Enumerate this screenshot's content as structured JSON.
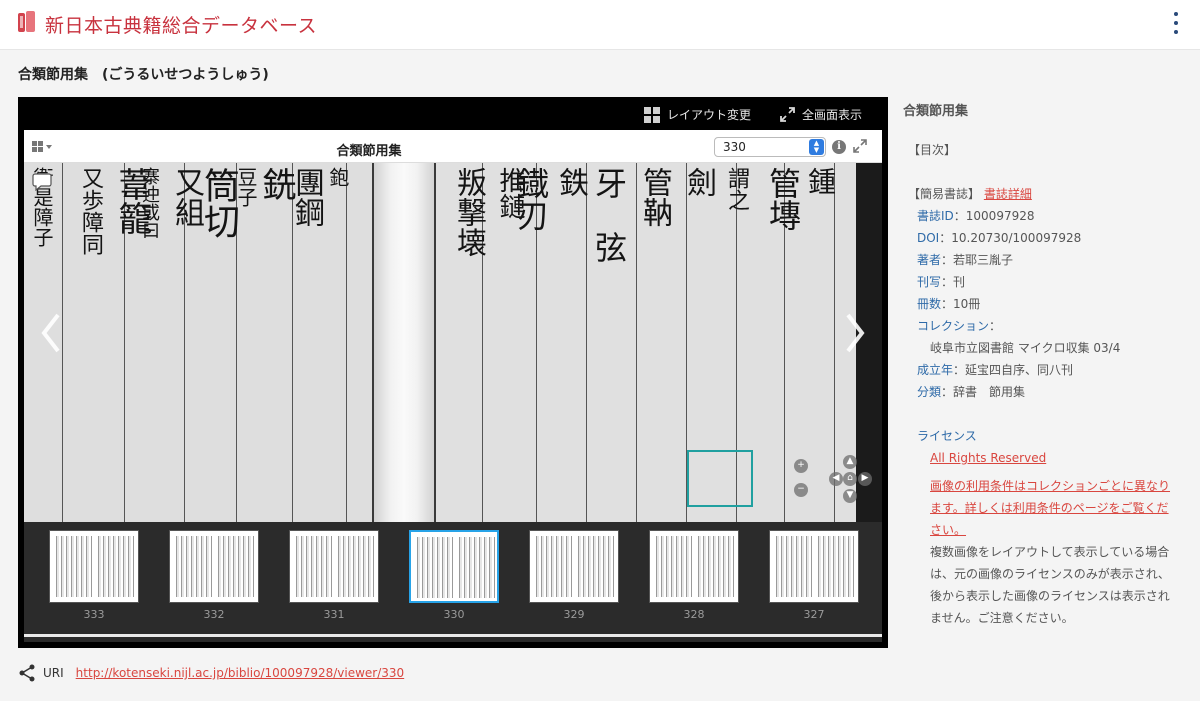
{
  "app": {
    "title": "新日本古典籍総合データベース"
  },
  "page": {
    "title": "合類節用集　(ごうるいせつようしゅう)"
  },
  "viewer": {
    "toolbar": {
      "layout_label": "レイアウト変更",
      "fullscreen_label": "全画面表示"
    },
    "inner_title": "合類節用集",
    "page_select_value": "330",
    "info_glyph": "i",
    "current_page": 330,
    "thumbnails": [
      {
        "label": "333"
      },
      {
        "label": "332"
      },
      {
        "label": "331"
      },
      {
        "label": "330"
      },
      {
        "label": "329"
      },
      {
        "label": "328"
      },
      {
        "label": "327"
      }
    ],
    "accent_color": "#27a3e8"
  },
  "side": {
    "title": "合類節用集",
    "toc": "【目次】",
    "bib_label": "【簡易書誌】",
    "bib_link": "書誌詳細",
    "fields": [
      {
        "label": "書誌ID",
        "value": "：100097928"
      },
      {
        "label": "DOI",
        "value": "：10.20730/100097928"
      },
      {
        "label": "著者",
        "value": "：若耶三胤子"
      },
      {
        "label": "刊写",
        "value": "：刊"
      },
      {
        "label": "冊数",
        "value": "：10冊"
      },
      {
        "label": "コレクション",
        "value": "："
      }
    ],
    "collection_value": "岐阜市立図書館 マイクロ収集 03/4",
    "fields2": [
      {
        "label": "成立年",
        "value": "：延宝四自序、同八刊"
      },
      {
        "label": "分類",
        "value": "：辞書　節用集"
      }
    ],
    "license_label": "ライセンス",
    "license_link": "All Rights Reserved",
    "license_notice_lines": [
      "画像の利用条件はコレクションごとに異なり",
      "ます。詳しくは利用条件のページをご覧くだ",
      "さい。"
    ],
    "layout_note_lines": [
      "複数画像をレイアウトして表示している場合",
      "は、元の画像のライセンスのみが表示され、",
      "後から表示した画像のライセンスは表示され",
      "ません。ご注意ください。"
    ]
  },
  "uri": {
    "label": "URI",
    "link": "http://kotenseki.nijl.ac.jp/biblio/100097928/viewer/330"
  },
  "colors": {
    "brand_red": "#c8323e",
    "link_red": "#d9463f",
    "label_blue": "#2e6aa8"
  }
}
